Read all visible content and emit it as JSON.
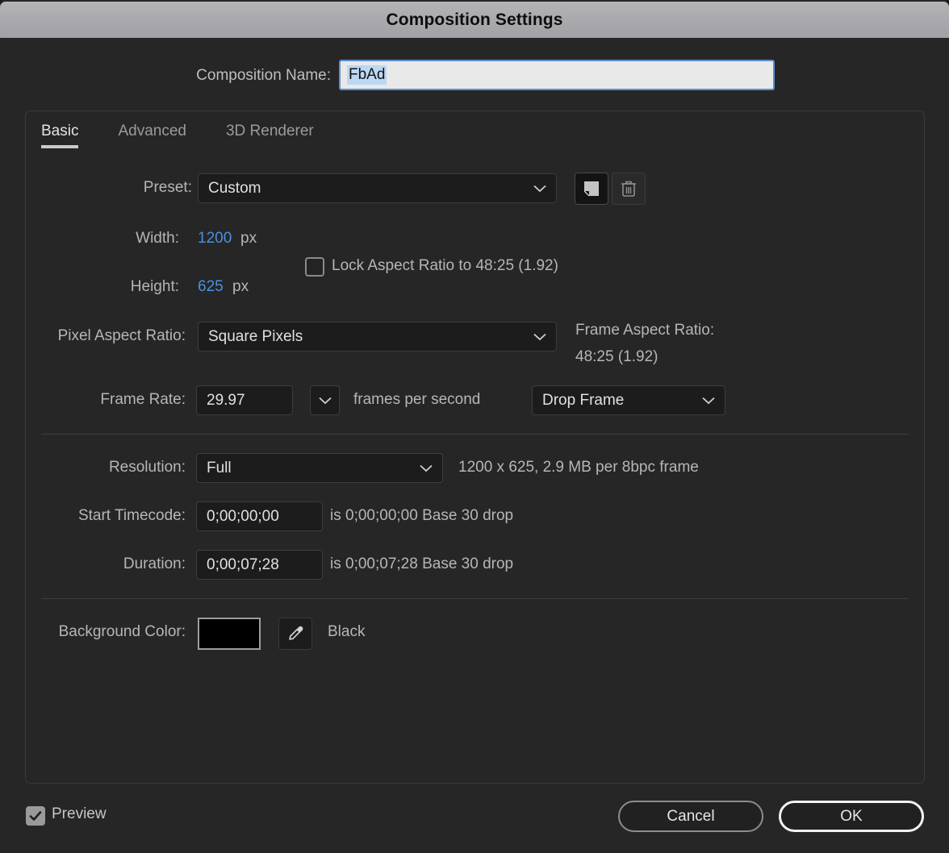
{
  "window": {
    "title": "Composition Settings"
  },
  "composition_name": {
    "label": "Composition Name:",
    "value": "FbAd"
  },
  "tabs": [
    {
      "label": "Basic",
      "active": true
    },
    {
      "label": "Advanced",
      "active": false
    },
    {
      "label": "3D Renderer",
      "active": false
    }
  ],
  "basic": {
    "preset": {
      "label": "Preset:",
      "value": "Custom",
      "save_icon": "new-preset-icon",
      "delete_icon": "trash-icon"
    },
    "width": {
      "label": "Width:",
      "value": "1200",
      "unit": "px"
    },
    "height": {
      "label": "Height:",
      "value": "625",
      "unit": "px"
    },
    "lock_aspect": {
      "label": "Lock Aspect Ratio to 48:25 (1.92)",
      "checked": false
    },
    "pixel_aspect_ratio": {
      "label": "Pixel Aspect Ratio:",
      "value": "Square Pixels"
    },
    "frame_aspect_ratio": {
      "label": "Frame Aspect Ratio:",
      "value": "48:25 (1.92)"
    },
    "frame_rate": {
      "label": "Frame Rate:",
      "value": "29.97",
      "unit": "frames per second",
      "drop_mode": "Drop Frame"
    },
    "resolution": {
      "label": "Resolution:",
      "value": "Full",
      "info": "1200 x 625, 2.9 MB per 8bpc frame"
    },
    "start_timecode": {
      "label": "Start Timecode:",
      "value": "0;00;00;00",
      "info": "is 0;00;00;00  Base 30  drop"
    },
    "duration": {
      "label": "Duration:",
      "value": "0;00;07;28",
      "info": "is 0;00;07;28  Base 30  drop"
    },
    "background_color": {
      "label": "Background Color:",
      "swatch_hex": "#000000",
      "name": "Black",
      "picker_icon": "eyedropper-icon"
    }
  },
  "footer": {
    "preview": {
      "label": "Preview",
      "checked": true
    },
    "cancel_label": "Cancel",
    "ok_label": "OK"
  },
  "colors": {
    "accent_blue": "#4a90e2",
    "focus_blue": "#5b8fd4",
    "selection_blue": "#bcd7f5",
    "panel_bg": "#262626",
    "field_bg": "#1c1c1c",
    "titlebar_gray": "#a9a8ad"
  }
}
